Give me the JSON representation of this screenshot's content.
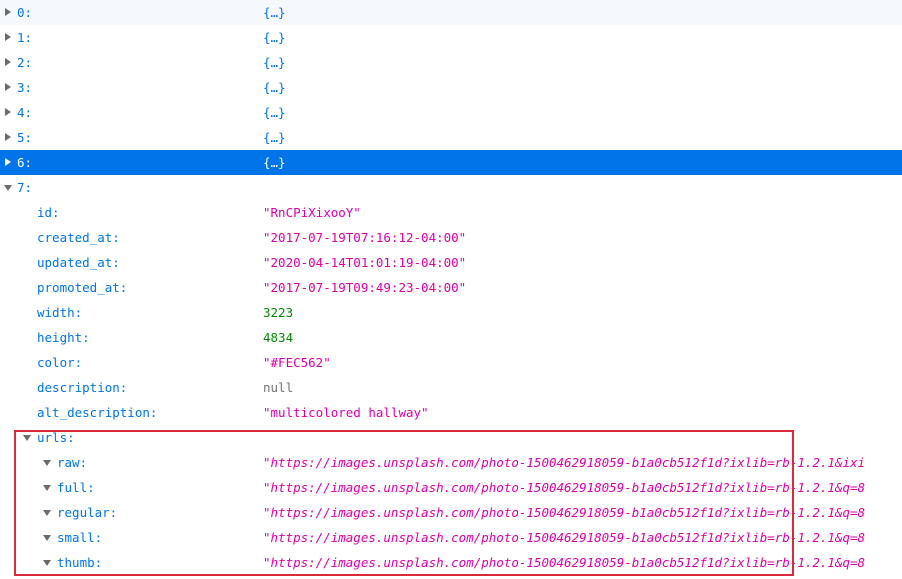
{
  "rows_collapsed": [
    {
      "key": "0:",
      "value": "{…}"
    },
    {
      "key": "1:",
      "value": "{…}"
    },
    {
      "key": "2:",
      "value": "{…}"
    },
    {
      "key": "3:",
      "value": "{…}"
    },
    {
      "key": "4:",
      "value": "{…}"
    },
    {
      "key": "5:",
      "value": "{…}"
    },
    {
      "key": "6:",
      "value": "{…}"
    }
  ],
  "item7": {
    "key": "7:",
    "fields": {
      "id": {
        "key": "id:",
        "value": "\"RnCPiXixooY\""
      },
      "created_at": {
        "key": "created_at:",
        "value": "\"2017-07-19T07:16:12-04:00\""
      },
      "updated_at": {
        "key": "updated_at:",
        "value": "\"2020-04-14T01:01:19-04:00\""
      },
      "promoted_at": {
        "key": "promoted_at:",
        "value": "\"2017-07-19T09:49:23-04:00\""
      },
      "width": {
        "key": "width:",
        "value": "3223"
      },
      "height": {
        "key": "height:",
        "value": "4834"
      },
      "color": {
        "key": "color:",
        "value": "\"#FEC562\""
      },
      "description": {
        "key": "description:",
        "value": "null"
      },
      "alt_description": {
        "key": "alt_description:",
        "value": "\"multicolored hallway\""
      }
    },
    "urls": {
      "key": "urls:",
      "raw": {
        "key": "raw:",
        "value": "\"https://images.unsplash.com/photo-1500462918059-b1a0cb512f1d?ixlib=rb-1.2.1&ixi"
      },
      "full": {
        "key": "full:",
        "value": "\"https://images.unsplash.com/photo-1500462918059-b1a0cb512f1d?ixlib=rb-1.2.1&q=8"
      },
      "regular": {
        "key": "regular:",
        "value": "\"https://images.unsplash.com/photo-1500462918059-b1a0cb512f1d?ixlib=rb-1.2.1&q=8"
      },
      "small": {
        "key": "small:",
        "value": "\"https://images.unsplash.com/photo-1500462918059-b1a0cb512f1d?ixlib=rb-1.2.1&q=8"
      },
      "thumb": {
        "key": "thumb:",
        "value": "\"https://images.unsplash.com/photo-1500462918059-b1a0cb512f1d?ixlib=rb-1.2.1&q=8"
      }
    }
  },
  "colors": {
    "key": "#0074e8",
    "string": "#dd00a9",
    "number": "#058b00",
    "null": "#737373",
    "selected_row": "#0074e8",
    "highlight_box": "#d92c3a"
  }
}
